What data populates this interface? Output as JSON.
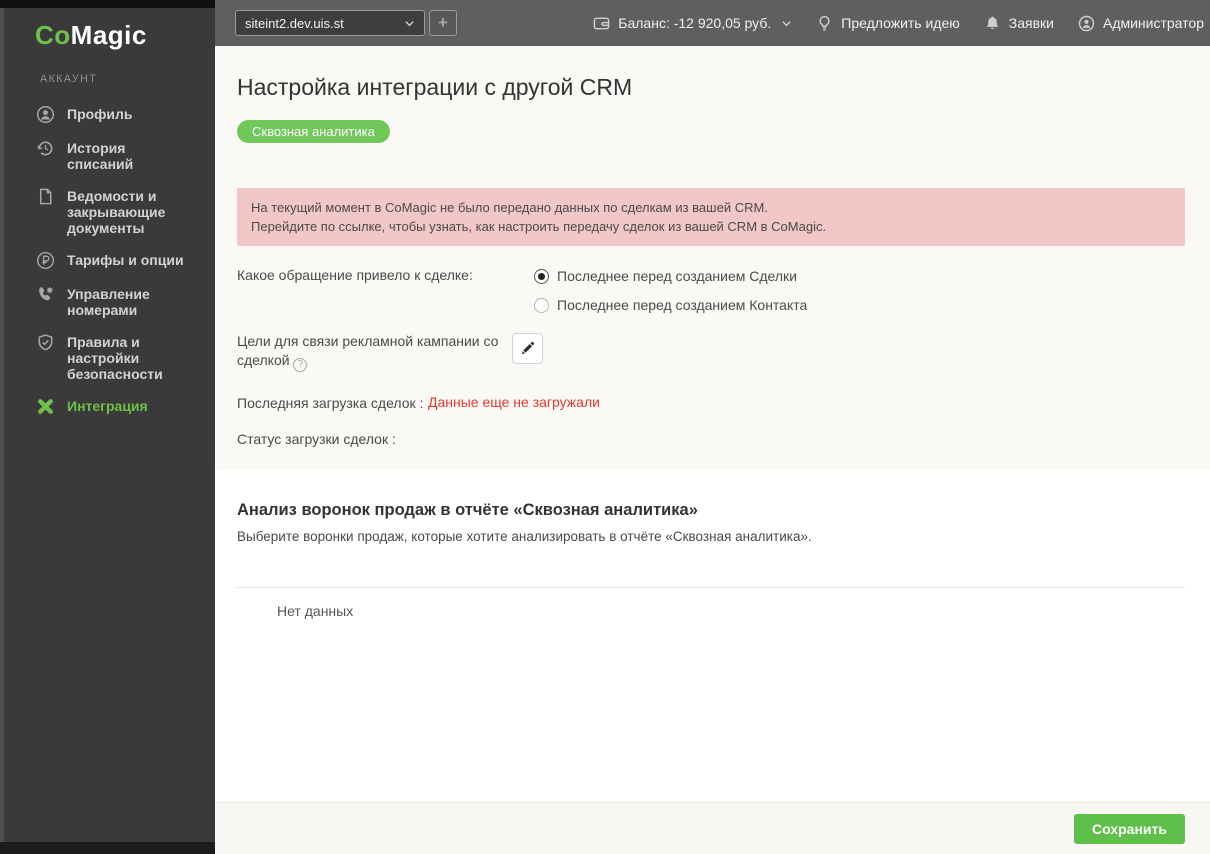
{
  "topbar": {
    "account_selector": {
      "value": "siteint2.dev.uis.st",
      "chevron_icon": "chevron-down-icon"
    },
    "add_label": "+",
    "balance": {
      "label": "Баланс: -12 920,05 руб.",
      "icon": "wallet-icon",
      "chevron_icon": "chevron-down-icon"
    },
    "suggest_idea": {
      "label": "Предложить идею",
      "icon": "lightbulb-icon"
    },
    "tickets": {
      "label": "Заявки",
      "icon": "bell-icon"
    },
    "user": {
      "label": "Администратор",
      "icon": "person-circle-icon"
    }
  },
  "sidebar": {
    "logo": {
      "part1": "Co",
      "part2": "Magic"
    },
    "section_label": "АККАУНТ",
    "items": [
      {
        "label": "Профиль",
        "icon": "profile-icon",
        "active": false
      },
      {
        "label": "История списаний",
        "icon": "history-icon",
        "active": false
      },
      {
        "label": "Ведомости и закрывающие документы",
        "icon": "document-icon",
        "active": false
      },
      {
        "label": "Тарифы и опции",
        "icon": "ruble-circle-icon",
        "active": false
      },
      {
        "label": "Управление номерами",
        "icon": "phone-gear-icon",
        "active": false
      },
      {
        "label": "Правила и настройки безопасности",
        "icon": "shield-check-icon",
        "active": false
      },
      {
        "label": "Интеграция",
        "icon": "integration-icon",
        "active": true
      }
    ]
  },
  "main": {
    "title": "Настройка интеграции с другой CRM",
    "badge": "Сквозная аналитика",
    "warning": {
      "line1": "На текущий момент в CoMagic не было передано данных по сделкам из вашей CRM.",
      "line2": "Перейдите по ссылке, чтобы узнать, как настроить передачу сделок из вашей CRM в CoMagic."
    },
    "deal_source": {
      "label": "Какое обращение привело к сделке:",
      "options": [
        {
          "label": "Последнее перед созданием Сделки",
          "selected": true
        },
        {
          "label": "Последнее перед созданием Контакта",
          "selected": false
        }
      ]
    },
    "goals": {
      "label": "Цели для связи рекламной кампании со сделкой",
      "help": "?",
      "edit_icon": "pencil-icon"
    },
    "last_upload": {
      "label": "Последняя загрузка сделок :",
      "value": "Данные еще не загружали"
    },
    "upload_status": {
      "label": "Статус загрузки сделок :",
      "value": ""
    },
    "funnels": {
      "title": "Анализ воронок продаж в отчёте «Сквозная аналитика»",
      "subtitle": "Выберите воронки продаж, которые хотите анализировать в отчёте «Сквозная аналитика».",
      "empty": "Нет данных"
    }
  },
  "footer": {
    "save_label": "Сохранить"
  },
  "colors": {
    "accent_green": "#6fbf4b",
    "badge_green": "#72c75a",
    "save_green": "#5ec049",
    "warning_bg": "#f2c7c7",
    "error_red": "#e23b2e",
    "sidebar_bg": "#3a3a3a",
    "topbar_bg": "#5f5f5f",
    "panel_bg": "#faf9f6"
  }
}
